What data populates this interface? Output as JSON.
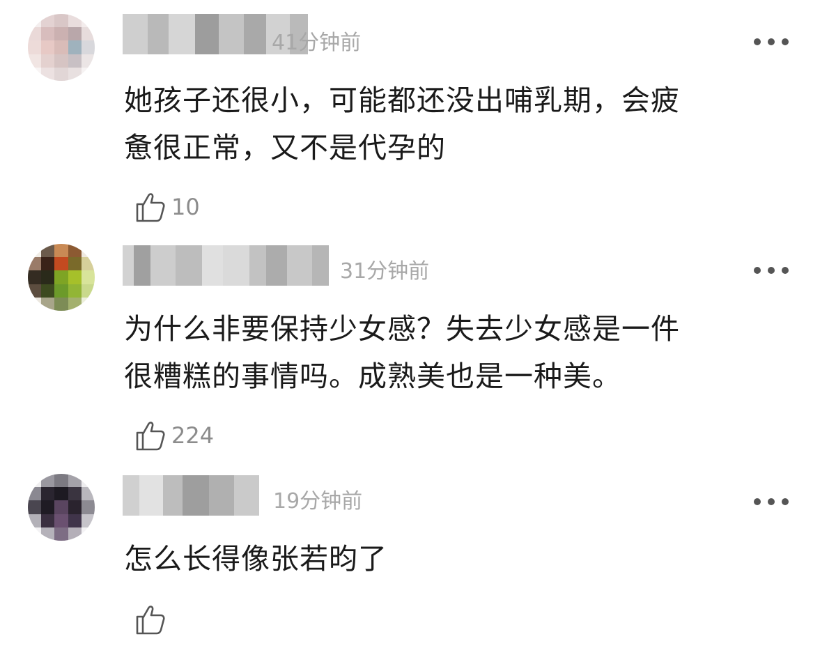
{
  "comments": [
    {
      "time": "41分钟前",
      "text_lines": [
        "她孩子还很小，可能都还没出哺乳期，会疲",
        "惫很正常，又不是代孕的"
      ],
      "likes": "10",
      "more_icon": "ellipsis-icon",
      "like_icon": "thumbs-up-icon"
    },
    {
      "time": "31分钟前",
      "text_lines": [
        "为什么非要保持少女感？失去少女感是一件",
        "很糟糕的事情吗。成熟美也是一种美。"
      ],
      "likes": "224",
      "more_icon": "ellipsis-icon",
      "like_icon": "thumbs-up-icon"
    },
    {
      "time": "19分钟前",
      "text_lines": [
        "怎么长得像张若昀了"
      ],
      "likes": "",
      "more_icon": "ellipsis-icon",
      "like_icon": "thumbs-up-icon"
    }
  ],
  "colors": {
    "text": "#1a1a1a",
    "muted": "#a8a8a8",
    "like_count": "#8c8c8c",
    "icon": "#555555"
  }
}
